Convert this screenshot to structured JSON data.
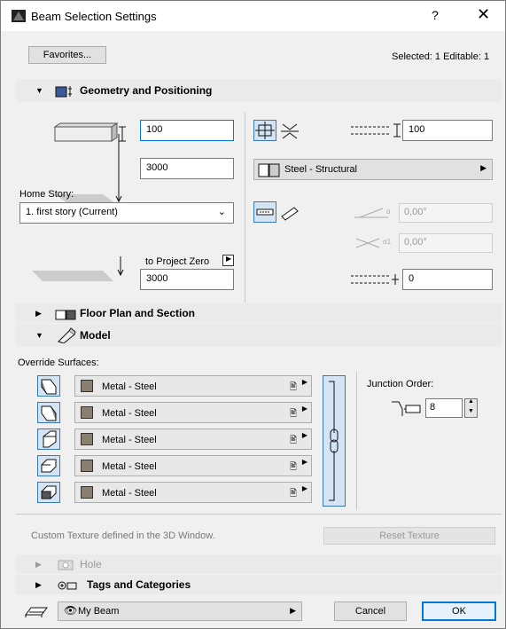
{
  "window": {
    "title": "Beam Selection Settings",
    "help_label": "?",
    "close_label": "✕"
  },
  "top": {
    "favorites_label": "Favorites...",
    "selected_info": "Selected: 1 Editable: 1"
  },
  "geometry": {
    "header": "Geometry and Positioning",
    "height_value": "100",
    "ref_height_value": "3000",
    "home_story_label": "Home Story:",
    "home_story_value": "1. first story (Current)",
    "to_project_zero_label": "to Project Zero",
    "project_zero_value": "3000",
    "width_value": "100",
    "building_material": "Steel - Structural",
    "slant_angle": "0,00°",
    "tilt_angle": "0,00°",
    "offset_value": "0"
  },
  "sections": {
    "floor_plan": "Floor Plan and Section",
    "model": "Model",
    "hole": "Hole",
    "tags": "Tags and Categories"
  },
  "model": {
    "override_label": "Override Surfaces:",
    "surfaces": [
      "Metal - Steel",
      "Metal - Steel",
      "Metal - Steel",
      "Metal - Steel",
      "Metal - Steel"
    ],
    "junction_label": "Junction Order:",
    "junction_value": "8",
    "texture_note": "Custom Texture defined in the 3D Window.",
    "reset_texture_label": "Reset Texture"
  },
  "bottom": {
    "layer_value": "My Beam",
    "cancel_label": "Cancel",
    "ok_label": "OK"
  },
  "colors": {
    "accent": "#0078d7",
    "icon_fill": "#d4e4f4",
    "icon_border": "#3a78b8",
    "swatch": "#8a7e6e"
  }
}
